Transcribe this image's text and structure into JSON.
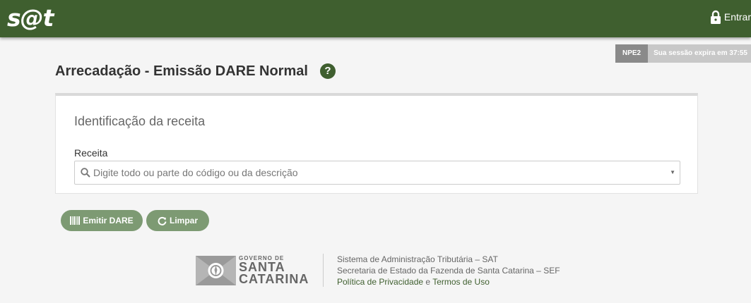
{
  "header": {
    "logo": "s@t",
    "login_label": "Entrar"
  },
  "session": {
    "env": "NPE2",
    "expire_text": "Sua sessão expira em 37:55"
  },
  "page": {
    "title": "Arrecadação - Emissão DARE Normal",
    "help_symbol": "?"
  },
  "panel": {
    "title": "Identificação da receita",
    "field_label": "Receita",
    "select_placeholder": "Digite todo ou parte do código ou da descrição"
  },
  "buttons": {
    "emit": "Emitir DARE",
    "clear": "Limpar"
  },
  "footer": {
    "gov_small": "GOVERNO DE",
    "gov_state_line1": "SANTA",
    "gov_state_line2": "CATARINA",
    "line1": "Sistema de Administração Tributária – SAT",
    "line2": "Secretaria de Estado da Fazenda de Santa Catarina – SEF",
    "privacy_link": "Política de Privacidade",
    "and": " e ",
    "terms_link": "Termos de Uso"
  },
  "colors": {
    "brand_green": "#3f5f2f",
    "button_green": "#7d9a73",
    "session_gray": "#8a8a8a"
  }
}
